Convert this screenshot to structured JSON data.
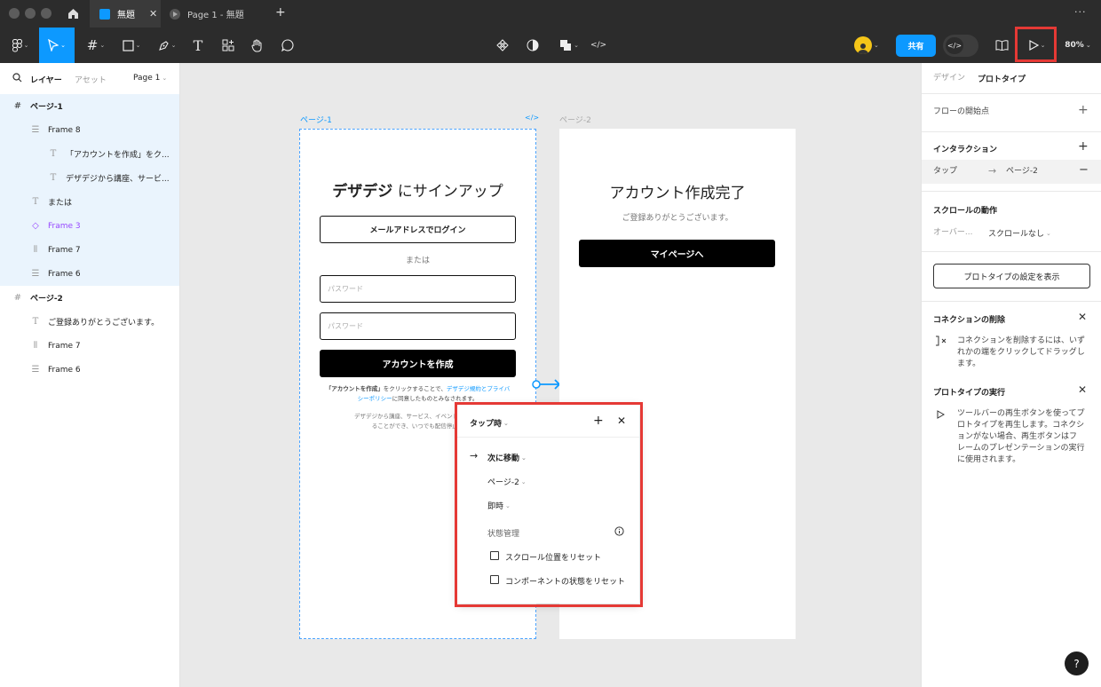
{
  "titlebar": {
    "tab1_title": "無題",
    "tab2_title": "Page 1 - 無題",
    "new_tab": "+",
    "more": "···"
  },
  "toolbar": {
    "share_label": "共有",
    "zoom_label": "80%"
  },
  "left_panel": {
    "tab_layers": "レイヤー",
    "tab_assets": "アセット",
    "page_select": "Page 1",
    "layers": [
      {
        "label": "ページ-1",
        "icon": "frame-hash-icon"
      },
      {
        "label": "Frame 8",
        "icon": "auto-layout-vertical-icon"
      },
      {
        "label": "「アカウントを作成」をク...",
        "icon": "text-icon"
      },
      {
        "label": "デザデジから講座、サービ...",
        "icon": "text-icon"
      },
      {
        "label": "または",
        "icon": "text-icon"
      },
      {
        "label": "Frame 3",
        "icon": "component-instance-icon"
      },
      {
        "label": "Frame 7",
        "icon": "auto-layout-horizontal-icon"
      },
      {
        "label": "Frame 6",
        "icon": "auto-layout-vertical-icon"
      },
      {
        "label": "ページ-2",
        "icon": "frame-hash-icon"
      },
      {
        "label": "ご登録ありがとうございます。",
        "icon": "text-icon"
      },
      {
        "label": "Frame 7",
        "icon": "auto-layout-horizontal-icon"
      },
      {
        "label": "Frame 6",
        "icon": "auto-layout-vertical-icon"
      }
    ]
  },
  "canvas": {
    "frame1": {
      "label": "ページ-1",
      "title_bold": "デザデジ",
      "title_rest": " にサインアップ",
      "email_login_btn": "メールアドレスでログイン",
      "or_text": "または",
      "password1_placeholder": "パスワード",
      "password2_placeholder": "パスワード",
      "create_btn": "アカウントを作成",
      "terms_line1_a": "「アカウントを作成」",
      "terms_line1_b": "をクリックすることで、",
      "terms_line1_link": "デザデジ規約とプライバ",
      "terms_line2_link": "シーポリシー",
      "terms_line2_b": "に同意したものとみなされます。",
      "promo_line1": "デザデジから講座、サービス、イベントに関する",
      "promo_line2": "ることができ、いつでも配信停止で"
    },
    "frame2": {
      "label": "ページ-2",
      "title": "アカウント作成完了",
      "subtitle": "ご登録ありがとうございます。",
      "mypage_btn": "マイページへ"
    },
    "popup": {
      "trigger": "タップ時",
      "action": "次に移動",
      "destination": "ページ-2",
      "animation": "即時",
      "state_section": "状態管理",
      "reset_scroll": "スクロール位置をリセット",
      "reset_component": "コンポーネントの状態をリセット"
    }
  },
  "right_panel": {
    "tab_design": "デザイン",
    "tab_prototype": "プロトタイプ",
    "flow_start": "フローの開始点",
    "interaction_title": "インタラクション",
    "interaction_trigger": "タップ",
    "interaction_target": "ページ-2",
    "scroll_title": "スクロールの動作",
    "overflow_label": "オーバー...",
    "scroll_value": "スクロールなし",
    "show_settings_btn": "プロトタイプの設定を表示",
    "remove_conn_title": "コネクションの削除",
    "remove_conn_lines": [
      "コネクションを削除するには、いず",
      "れかの端をクリックしてドラッグし",
      "ます。"
    ],
    "run_title": "プロトタイプの実行",
    "run_lines": [
      "ツールバーの再生ボタンを使ってプ",
      "ロトタイプを再生します。コネクシ",
      "ョンがない場合、再生ボタンはフ",
      "レームのプレゼンテーションの実行",
      "に使用されます。"
    ]
  },
  "help": "?",
  "colors": {
    "accent": "#0d99ff",
    "selection_bg": "#eaf4fd",
    "highlight_red": "#e53935",
    "component_purple": "#9747ff",
    "toolbar_bg": "#2c2c2c"
  }
}
